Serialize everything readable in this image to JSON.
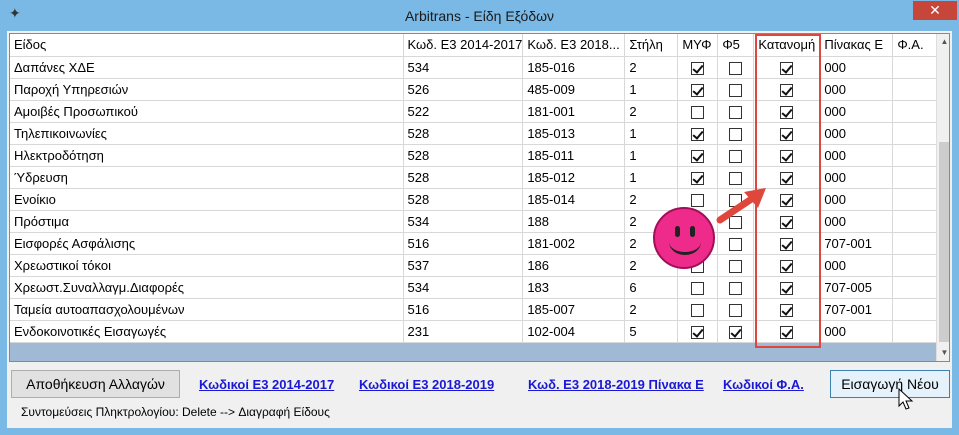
{
  "window": {
    "title": "Arbitrans - Είδη Εξόδων",
    "app_icon": "bird-icon",
    "close_label": "✕"
  },
  "grid": {
    "columns": [
      "Είδος",
      "Κωδ. Ε3 2014-2017",
      "Κωδ. Ε3 2018...",
      "Στήλη",
      "ΜΥΦ",
      "Φ5",
      "Κατανομή",
      "Πίνακας Ε",
      "Φ.Α."
    ],
    "rows": [
      {
        "name": "Δαπάνες ΧΔΕ",
        "e3_2014": "534",
        "e3_2018": "185-016",
        "stili": "2",
        "myf": true,
        "f5": false,
        "katanomi": true,
        "pinakas": "000",
        "fa": ""
      },
      {
        "name": "Παροχή Υπηρεσιών",
        "e3_2014": "526",
        "e3_2018": "485-009",
        "stili": "1",
        "myf": true,
        "f5": false,
        "katanomi": true,
        "pinakas": "000",
        "fa": ""
      },
      {
        "name": "Αμοιβές Προσωπικού",
        "e3_2014": "522",
        "e3_2018": "181-001",
        "stili": "2",
        "myf": false,
        "f5": false,
        "katanomi": true,
        "pinakas": "000",
        "fa": ""
      },
      {
        "name": "Τηλεπικοινωνίες",
        "e3_2014": "528",
        "e3_2018": "185-013",
        "stili": "1",
        "myf": true,
        "f5": false,
        "katanomi": true,
        "pinakas": "000",
        "fa": ""
      },
      {
        "name": "Ηλεκτροδότηση",
        "e3_2014": "528",
        "e3_2018": "185-011",
        "stili": "1",
        "myf": true,
        "f5": false,
        "katanomi": true,
        "pinakas": "000",
        "fa": ""
      },
      {
        "name": "Ύδρευση",
        "e3_2014": "528",
        "e3_2018": "185-012",
        "stili": "1",
        "myf": true,
        "f5": false,
        "katanomi": true,
        "pinakas": "000",
        "fa": ""
      },
      {
        "name": "Ενοίκιο",
        "e3_2014": "528",
        "e3_2018": "185-014",
        "stili": "2",
        "myf": false,
        "f5": false,
        "katanomi": true,
        "pinakas": "000",
        "fa": ""
      },
      {
        "name": "Πρόστιμα",
        "e3_2014": "534",
        "e3_2018": "188",
        "stili": "2",
        "myf": false,
        "f5": false,
        "katanomi": true,
        "pinakas": "000",
        "fa": ""
      },
      {
        "name": "Εισφορές Ασφάλισης",
        "e3_2014": "516",
        "e3_2018": "181-002",
        "stili": "2",
        "myf": false,
        "f5": false,
        "katanomi": true,
        "pinakas": "707-001",
        "fa": ""
      },
      {
        "name": "Χρεωστικοί τόκοι",
        "e3_2014": "537",
        "e3_2018": "186",
        "stili": "2",
        "myf": false,
        "f5": false,
        "katanomi": true,
        "pinakas": "000",
        "fa": ""
      },
      {
        "name": "Χρεωστ.Συναλλαγμ.Διαφορές",
        "e3_2014": "534",
        "e3_2018": "183",
        "stili": "6",
        "myf": false,
        "f5": false,
        "katanomi": true,
        "pinakas": "707-005",
        "fa": ""
      },
      {
        "name": "Ταμεία αυτοαπασχολουμένων",
        "e3_2014": "516",
        "e3_2018": "185-007",
        "stili": "2",
        "myf": false,
        "f5": false,
        "katanomi": true,
        "pinakas": "707-001",
        "fa": ""
      },
      {
        "name": "Ενδοκοινοτικές Εισαγωγές",
        "e3_2014": "231",
        "e3_2018": "102-004",
        "stili": "5",
        "myf": true,
        "f5": true,
        "katanomi": true,
        "pinakas": "000",
        "fa": ""
      }
    ]
  },
  "footer": {
    "save_label": "Αποθήκευση Αλλαγών",
    "links": [
      "Κωδικοί Ε3 2014-2017",
      "Κωδικοί Ε3 2018-2019",
      "Κωδ. Ε3 2018-2019 Πίνακα Ε",
      "Κωδικοί Φ.Α."
    ],
    "new_label": "Εισαγωγή Νέου",
    "shortcut_text": "Συντομεύσεις Πληκτρολογίου: Delete --> Διαγραφή Είδους"
  },
  "colors": {
    "highlight": "#e0473c",
    "smiley": "#ee2b8a",
    "link": "#1a18d4",
    "titlebar": "#7ab9e6"
  }
}
